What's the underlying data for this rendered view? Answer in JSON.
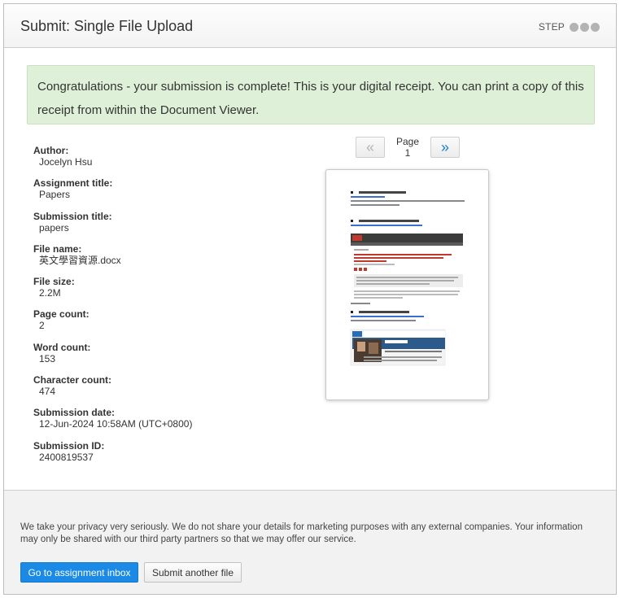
{
  "header": {
    "title": "Submit: Single File Upload",
    "step_label": "STEP",
    "step_dots": 3
  },
  "receipt": {
    "message": "Congratulations - your submission is complete! This is your digital receipt. You can print a copy of this receipt from within the Document Viewer."
  },
  "details": [
    {
      "label": "Author:",
      "value": "Jocelyn Hsu"
    },
    {
      "label": "Assignment title:",
      "value": "Papers"
    },
    {
      "label": "Submission title:",
      "value": "papers"
    },
    {
      "label": "File name:",
      "value": "英文學習資源.docx"
    },
    {
      "label": "File size:",
      "value": "2.2M"
    },
    {
      "label": "Page count:",
      "value": "2"
    },
    {
      "label": "Word count:",
      "value": "153"
    },
    {
      "label": "Character count:",
      "value": "474"
    },
    {
      "label": "Submission date:",
      "value": "12-Jun-2024 10:58AM (UTC+0800)"
    },
    {
      "label": "Submission ID:",
      "value": "2400819537"
    }
  ],
  "viewer": {
    "prev_icon": "«",
    "next_icon": "»",
    "page_label": "Page 1"
  },
  "footer": {
    "privacy_text": "We take your privacy very seriously. We do not share your details for marketing purposes with any external companies. Your information may only be shared with our third party partners so that we may offer our service.",
    "primary_button": "Go to assignment inbox",
    "secondary_button": "Submit another file"
  },
  "colors": {
    "success_bg": "#dff0d8",
    "primary_button": "#1a8ae6",
    "next_arrow": "#1b7fd1"
  }
}
